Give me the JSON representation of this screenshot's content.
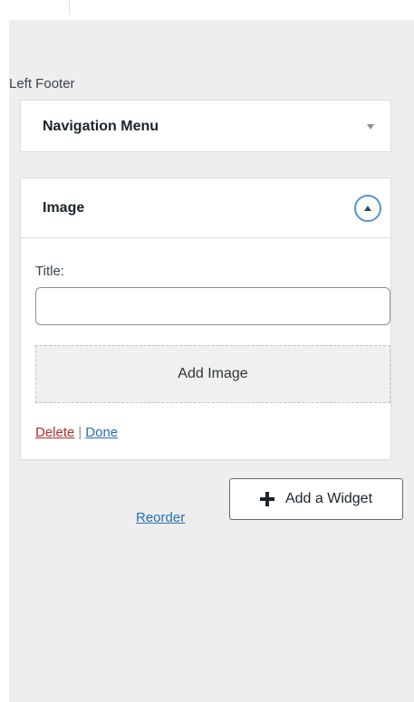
{
  "sidebar_section": {
    "area_title": "Left Footer"
  },
  "widgets": [
    {
      "title": "Navigation Menu",
      "state": "collapsed",
      "toggle_icon": "caret-down-icon"
    },
    {
      "title": "Image",
      "state": "expanded",
      "toggle_icon": "caret-up-circle-icon",
      "fields": {
        "title_label": "Title:",
        "title_value": "",
        "title_placeholder": ""
      },
      "add_image_label": "Add Image",
      "actions": {
        "delete_label": "Delete",
        "separator": "|",
        "done_label": "Done"
      }
    }
  ],
  "footer_actions": {
    "reorder_label": "Reorder",
    "add_widget_label": "Add a Widget",
    "add_widget_icon": "plus-icon"
  },
  "colors": {
    "panel_background": "#eeeeee",
    "link_blue": "#2271b1",
    "delete_red": "#b32d2e",
    "toggle_ring": "#4f94d4"
  }
}
